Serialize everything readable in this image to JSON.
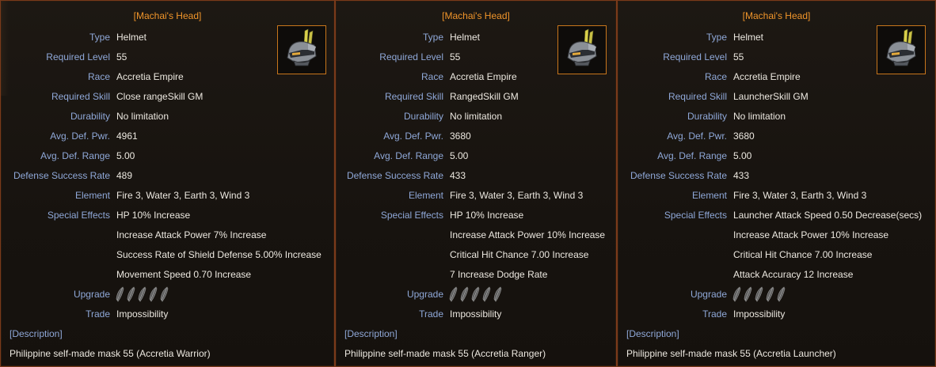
{
  "panels": [
    {
      "title": "[Machai's Head]",
      "item_icon": "helmet-icon",
      "labels": {
        "type": "Type",
        "level": "Required Level",
        "race": "Race",
        "skill": "Required Skill",
        "durability": "Durability",
        "def_pwr": "Avg. Def. Pwr.",
        "def_range": "Avg. Def. Range",
        "def_rate": "Defense Success Rate",
        "element": "Element",
        "special": "Special Effects",
        "upgrade": "Upgrade",
        "trade": "Trade"
      },
      "values": {
        "type": "Helmet",
        "level": "55",
        "race": "Accretia Empire",
        "skill": "Close rangeSkill GM",
        "durability": "No limitation",
        "def_pwr": "4961",
        "def_range": "5.00",
        "def_rate": "489",
        "element": "Fire 3, Water 3, Earth 3, Wind 3",
        "trade": "Impossibility"
      },
      "special_effects": [
        "HP 10% Increase",
        "Increase Attack Power 7% Increase",
        "Success Rate of Shield Defense 5.00% Increase",
        "Movement Speed 0.70 Increase"
      ],
      "upgrade_slots": 5,
      "upgrade_icon": "feather-icon",
      "description_header": "[Description]",
      "description": "Philippine self-made mask 55 (Accretia Warrior)"
    },
    {
      "title": "[Machai's Head]",
      "item_icon": "helmet-icon",
      "labels": {
        "type": "Type",
        "level": "Required Level",
        "race": "Race",
        "skill": "Required Skill",
        "durability": "Durability",
        "def_pwr": "Avg. Def. Pwr.",
        "def_range": "Avg. Def. Range",
        "def_rate": "Defense Success Rate",
        "element": "Element",
        "special": "Special Effects",
        "upgrade": "Upgrade",
        "trade": "Trade"
      },
      "values": {
        "type": "Helmet",
        "level": "55",
        "race": "Accretia Empire",
        "skill": "RangedSkill GM",
        "durability": "No limitation",
        "def_pwr": "3680",
        "def_range": "5.00",
        "def_rate": "433",
        "element": "Fire 3, Water 3, Earth 3, Wind 3",
        "trade": "Impossibility"
      },
      "special_effects": [
        "HP 10% Increase",
        "Increase Attack Power 10% Increase",
        "Critical Hit Chance 7.00 Increase",
        "7 Increase Dodge Rate"
      ],
      "upgrade_slots": 5,
      "upgrade_icon": "feather-icon",
      "description_header": "[Description]",
      "description": "Philippine self-made mask 55 (Accretia Ranger)"
    },
    {
      "title": "[Machai's Head]",
      "item_icon": "helmet-icon",
      "labels": {
        "type": "Type",
        "level": "Required Level",
        "race": "Race",
        "skill": "Required Skill",
        "durability": "Durability",
        "def_pwr": "Avg. Def. Pwr.",
        "def_range": "Avg. Def. Range",
        "def_rate": "Defense Success Rate",
        "element": "Element",
        "special": "Special Effects",
        "upgrade": "Upgrade",
        "trade": "Trade"
      },
      "values": {
        "type": "Helmet",
        "level": "55",
        "race": "Accretia Empire",
        "skill": "LauncherSkill GM",
        "durability": "No limitation",
        "def_pwr": "3680",
        "def_range": "5.00",
        "def_rate": "433",
        "element": "Fire 3, Water 3, Earth 3, Wind 3",
        "trade": "Impossibility"
      },
      "special_effects": [
        "Launcher Attack Speed 0.50 Decrease(secs)",
        "Increase Attack Power 10% Increase",
        "Critical Hit Chance 7.00 Increase",
        "Attack Accuracy 12 Increase"
      ],
      "upgrade_slots": 5,
      "upgrade_icon": "feather-icon",
      "description_header": "[Description]",
      "description": "Philippine self-made mask 55 (Accretia Launcher)"
    }
  ],
  "colors": {
    "title": "#f0952a",
    "label": "#8fa8d8",
    "value": "#ece8e0",
    "border": "#7a3a1a",
    "icon_border": "#c8761c"
  }
}
